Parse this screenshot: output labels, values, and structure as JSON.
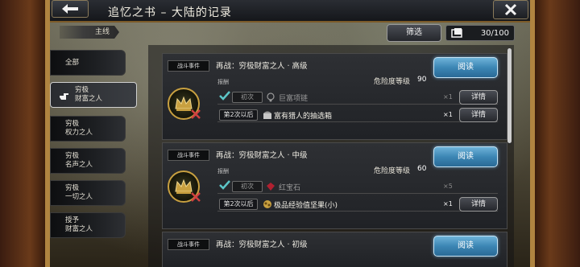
{
  "window": {
    "title": "追忆之书 – 大陆的记录"
  },
  "tabs": {
    "main": "主线"
  },
  "toolbar": {
    "filter_label": "筛选",
    "counter": "30/100"
  },
  "sidebar": {
    "items": [
      {
        "label1": "全部",
        "label2": ""
      },
      {
        "label1": "穷极",
        "label2": "财富之人",
        "active": true
      },
      {
        "label1": "穷极",
        "label2": "权力之人"
      },
      {
        "label1": "穷极",
        "label2": "名声之人"
      },
      {
        "label1": "穷极",
        "label2": "一切之人"
      },
      {
        "label1": "授予",
        "label2": "财富之人"
      }
    ]
  },
  "cards": [
    {
      "tag": "战斗事件",
      "title": "再战：穷极财富之人 · 高级",
      "read_label": "阅读",
      "reward_label": "报酬",
      "danger_label": "危险度等级",
      "danger_value": "90",
      "first_label": "初次",
      "first_item": "巨富项链",
      "first_qty": "×1",
      "detail_label": "详情",
      "repeat_label": "第2次以后",
      "repeat_item": "富有猎人的抽选箱",
      "repeat_qty": "×1"
    },
    {
      "tag": "战斗事件",
      "title": "再战：穷极财富之人 · 中级",
      "read_label": "阅读",
      "reward_label": "报酬",
      "danger_label": "危险度等级",
      "danger_value": "60",
      "first_label": "初次",
      "first_item": "红宝石",
      "first_qty": "×5",
      "detail_label": "详情",
      "repeat_label": "第2次以后",
      "repeat_item": "极品经验值坚果(小)",
      "repeat_qty": "×1"
    },
    {
      "tag": "战斗事件",
      "title": "再战：穷极财富之人 · 初级",
      "read_label": "阅读"
    }
  ],
  "colors": {
    "accent_blue": "#3c86b4",
    "check_teal": "#5cc6c8",
    "gold": "#c8a040"
  }
}
